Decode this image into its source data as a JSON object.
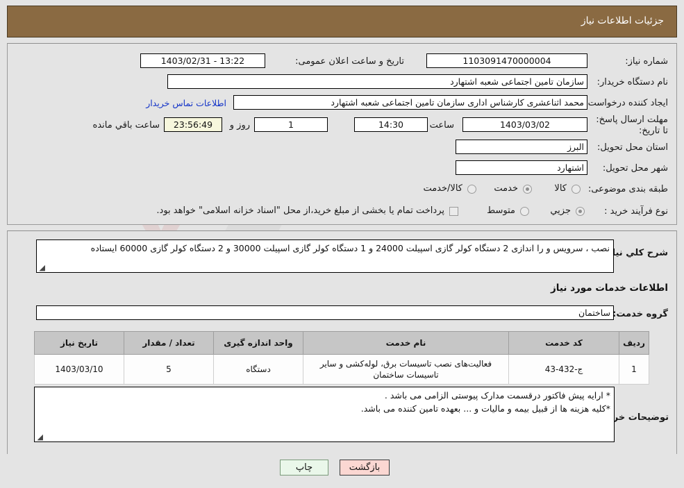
{
  "header": {
    "title": "جزئیات اطلاعات نیاز"
  },
  "main": {
    "need_number_label": "شماره نیاز:",
    "need_number_value": "1103091470000004",
    "announce_label": "تاریخ و ساعت اعلان عمومی:",
    "announce_value": "13:22 - 1403/02/31",
    "buyer_org_label": "نام دستگاه خریدار:",
    "buyer_org_value": "سازمان تامین اجتماعی شعبه اشتهارد",
    "creator_label": "ایجاد کننده درخواست:",
    "creator_value": "محمد اثناعشری کارشناس اداری سازمان تامین اجتماعی شعبه اشتهارد",
    "contact_link": "اطلاعات تماس خریدار",
    "deadline_label": "مهلت ارسال پاسخ: تا تاریخ:",
    "deadline_date": "1403/03/02",
    "hour_label": "ساعت",
    "hour_value": "14:30",
    "days_value": "1",
    "days_suffix_label": "روز و",
    "countdown_value": "23:56:49",
    "countdown_suffix_label": "ساعت باقي مانده",
    "province_label": "استان محل تحویل:",
    "province_value": "البرز",
    "city_label": "شهر محل تحویل:",
    "city_value": "اشتهارد",
    "category_label": "طبقه بندی موضوعی:",
    "category_options": [
      {
        "label": "کالا",
        "selected": false
      },
      {
        "label": "خدمت",
        "selected": true
      },
      {
        "label": "کالا/خدمت",
        "selected": false
      }
    ],
    "process_label": "نوع فرآیند خرید :",
    "process_options": [
      {
        "label": "جزیي",
        "selected": true
      },
      {
        "label": "متوسط",
        "selected": false
      }
    ],
    "treasury_checkbox_label": "پرداخت تمام یا بخشی از مبلغ خرید،از محل \"اسناد خزانه اسلامی\" خواهد بود.",
    "treasury_checked": false
  },
  "description": {
    "label": "شرح کلي نیاز:",
    "value": "نصب ، سرویس و را اندازی 2 دستگاه کولر گازی اسپیلت 24000 و 1 دستگاه کولر گازی اسپیلت 30000 و 2 دستگاه کولر گازی 60000 ایستاده"
  },
  "services": {
    "section_title": "اطلاعات خدمات مورد نیاز",
    "group_label": "گروه خدمت:",
    "group_value": "ساختمان",
    "columns": [
      "ردیف",
      "کد خدمت",
      "نام خدمت",
      "واحد اندازه گیری",
      "تعداد / مقدار",
      "تاریخ نیاز"
    ],
    "rows": [
      {
        "idx": "1",
        "code": "ج-432-43",
        "name": "فعالیت‌های نصب تاسیسات برق، لوله‌کشی و سایر تاسیسات ساختمان",
        "unit": "دستگاه",
        "qty": "5",
        "date": "1403/03/10"
      }
    ]
  },
  "buyer_notes": {
    "label": "توضیحات خریدار:",
    "line1": "* ارایه پیش فاکتور درقسمت مدارک پیوستی الزامی می باشد .",
    "line2": "*کلیه هزینه ها از قبیل بیمه و مالیات و ... بعهده تامین کننده می باشد."
  },
  "footer": {
    "print_label": "چاپ",
    "back_label": "بازگشت"
  },
  "watermark": {
    "text": "AriaTender.net"
  },
  "colors": {
    "header_bg": "#8a6a42",
    "page_bg": "#e4e4e4",
    "link": "#1434c8",
    "print_btn_bg": "#eaf7ea",
    "back_btn_bg": "#fbd7d2",
    "countdown_bg": "#f7f7dd",
    "table_header_bg": "#c6c6c6"
  }
}
